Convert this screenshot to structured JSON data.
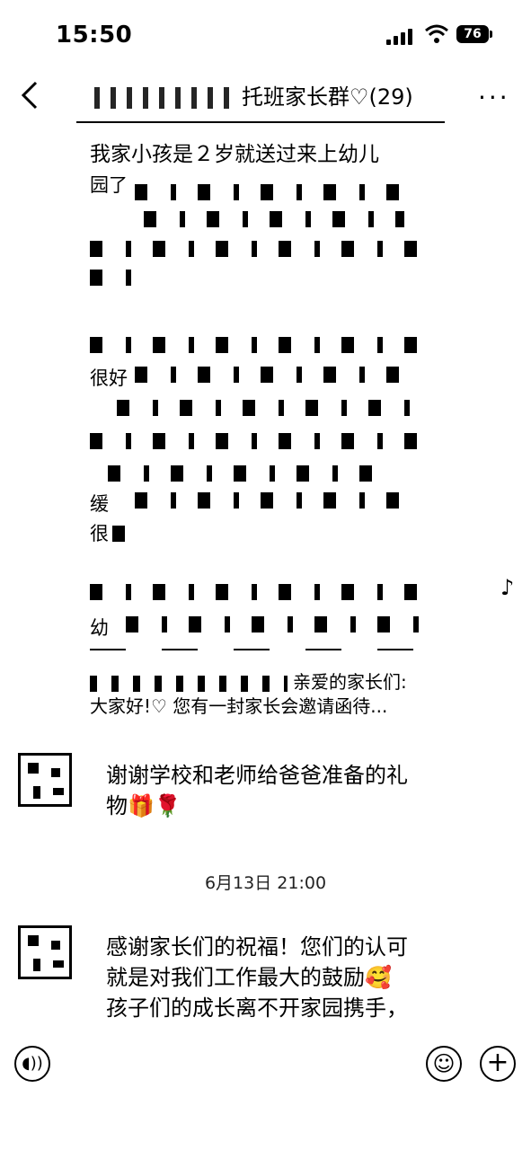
{
  "status_bar": {
    "time": "15:50",
    "battery": "76"
  },
  "header": {
    "back_icon": "chevron-left-icon",
    "title": "托班家长群♡(29)",
    "more_label": "···"
  },
  "shared_post": {
    "first_line": "我家小孩是２岁就送过来上幼儿",
    "fragments": [
      "园了",
      "很好",
      "缓",
      "很",
      "幼"
    ],
    "share_line1": "亲爱的家长们:",
    "share_line2": "大家好!♡ 您有一封家长会邀请函待..."
  },
  "messages": [
    {
      "text_line1": "谢谢学校和老师给爸爸准备的礼",
      "text_line2": "物🎁🌹"
    },
    {
      "text_line1": "感谢家长们的祝福！您们的认可",
      "text_line2": "就是对我们工作最大的鼓励🥰",
      "text_line3": "孩子们的成长离不开家园携手，"
    }
  ],
  "timestamp": "6月13日 21:00",
  "input_bar": {
    "voice_icon": "voice-icon",
    "emoji_icon": "emoji-icon",
    "plus_icon": "plus-icon"
  }
}
